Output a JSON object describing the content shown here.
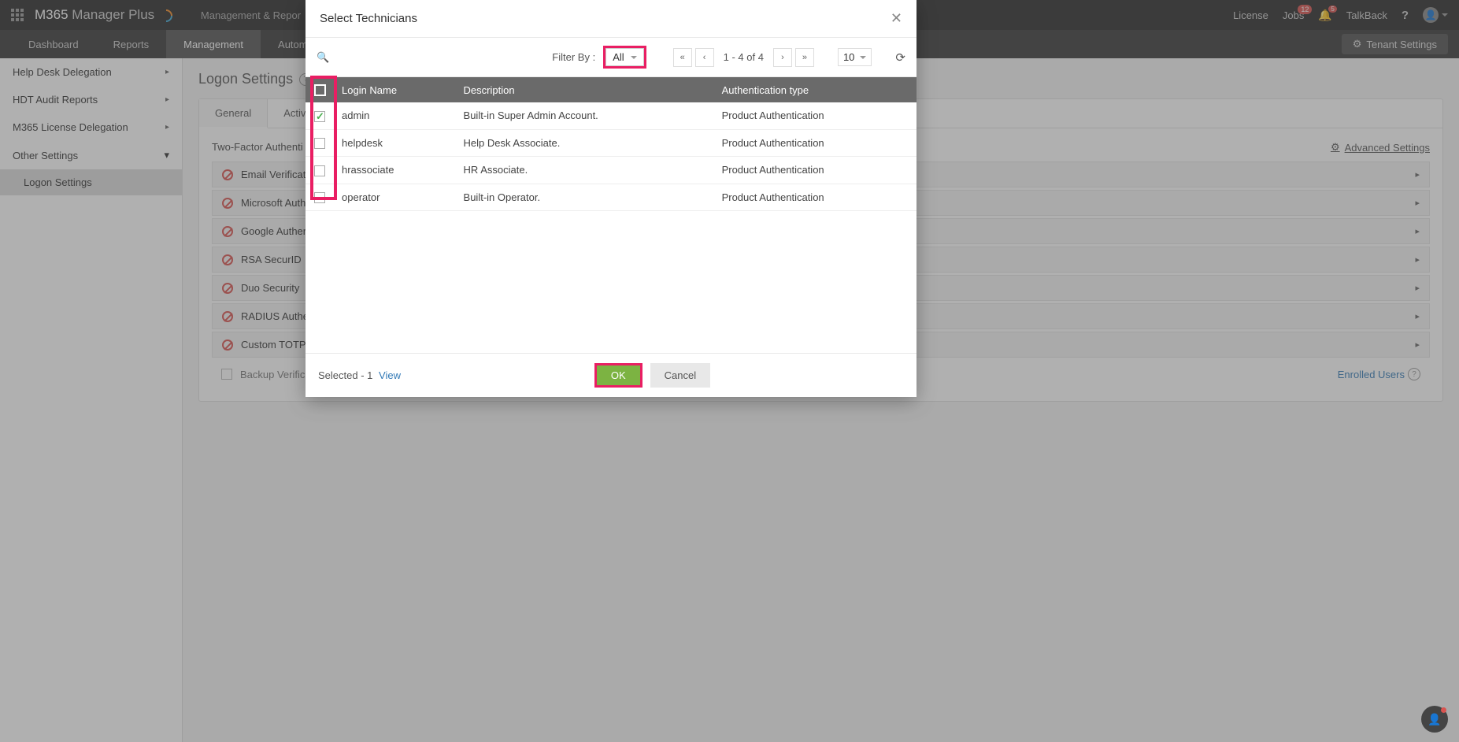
{
  "header": {
    "logo_main": "M365",
    "logo_sub": "Manager Plus",
    "nav_text": "Management & Repor",
    "right": {
      "license": "License",
      "jobs": "Jobs",
      "jobs_badge": "12",
      "bell_badge": "5",
      "talkback": "TalkBack"
    }
  },
  "tabs": {
    "dashboard": "Dashboard",
    "reports": "Reports",
    "management": "Management",
    "automation": "Automa",
    "tenant_btn": "Tenant Settings"
  },
  "sidebar": {
    "help_desk": "Help Desk Delegation",
    "hdt_audit": "HDT Audit Reports",
    "m365_license": "M365 License Delegation",
    "other": "Other Settings",
    "logon": "Logon Settings"
  },
  "page": {
    "title": "Logon Settings",
    "tab_general": "General",
    "tab_active": "Active D",
    "section": "Two-Factor Authenti",
    "advanced": "Advanced Settings",
    "auth_items": {
      "email": "Email Verificat",
      "microsoft": "Microsoft Auth",
      "google": "Google Authen",
      "rsa": "RSA SecurID",
      "duo": "Duo Security",
      "radius": "RADIUS Auther",
      "totp": "Custom TOTP A"
    },
    "backup": "Backup Verificat",
    "enrolled": "Enrolled Users"
  },
  "modal": {
    "title": "Select Technicians",
    "filter_label": "Filter By :",
    "filter_value": "All",
    "pager_text": "1 - 4 of 4",
    "pagesize": "10",
    "columns": {
      "login": "Login Name",
      "desc": "Description",
      "auth": "Authentication type"
    },
    "rows": [
      {
        "login": "admin",
        "desc": "Built-in Super Admin Account.",
        "auth": "Product Authentication",
        "checked": true
      },
      {
        "login": "helpdesk",
        "desc": "Help Desk Associate.",
        "auth": "Product Authentication",
        "checked": false
      },
      {
        "login": "hrassociate",
        "desc": "HR Associate.",
        "auth": "Product Authentication",
        "checked": false
      },
      {
        "login": "operator",
        "desc": "Built-in Operator.",
        "auth": "Product Authentication",
        "checked": false
      }
    ],
    "selected_label": "Selected -",
    "selected_count": "1",
    "view": "View",
    "ok": "OK",
    "cancel": "Cancel"
  }
}
